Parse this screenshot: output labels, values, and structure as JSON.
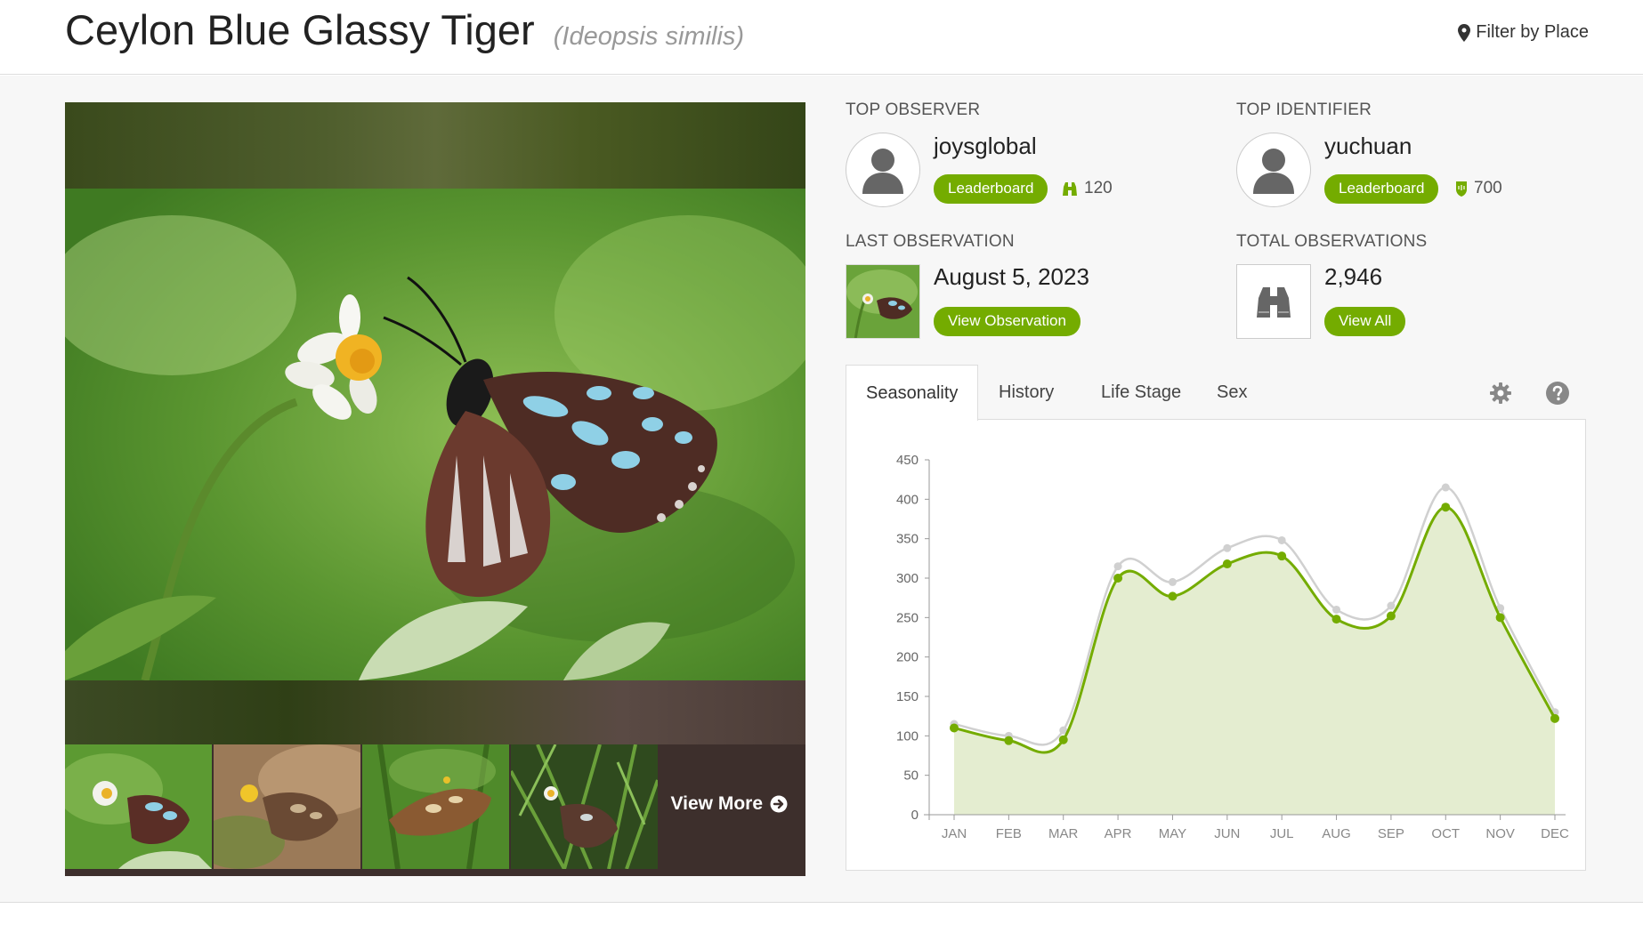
{
  "header": {
    "common_name": "Ceylon Blue Glassy Tiger",
    "scientific_name": "Ideopsis similis",
    "filter_label": "Filter by Place"
  },
  "photos": {
    "view_more_label": "View More"
  },
  "top_observer": {
    "label": "TOP OBSERVER",
    "name": "joysglobal",
    "leaderboard_label": "Leaderboard",
    "count": "120"
  },
  "top_identifier": {
    "label": "TOP IDENTIFIER",
    "name": "yuchuan",
    "leaderboard_label": "Leaderboard",
    "count": "700"
  },
  "last_observation": {
    "label": "LAST OBSERVATION",
    "date": "August 5, 2023",
    "button_label": "View Observation"
  },
  "total_observations": {
    "label": "TOTAL OBSERVATIONS",
    "value": "2,946",
    "button_label": "View All"
  },
  "tabs": [
    {
      "label": "Seasonality",
      "active": true
    },
    {
      "label": "History",
      "active": false
    },
    {
      "label": "Life Stage",
      "active": false
    },
    {
      "label": "Sex",
      "active": false
    }
  ],
  "icons": {
    "filter": "map-pin-icon",
    "view_more": "arrow-circle-right-icon",
    "observer_count": "binoculars-icon",
    "identifier_count": "shield-icon",
    "settings": "gear-icon",
    "help": "question-circle-icon"
  },
  "colors": {
    "accent": "#74ac00",
    "series_research": "#74ac00",
    "series_all": "#d0d0d0",
    "area_fill": "#e4edd0"
  },
  "chart_data": {
    "type": "line",
    "categories": [
      "JAN",
      "FEB",
      "MAR",
      "APR",
      "MAY",
      "JUN",
      "JUL",
      "AUG",
      "SEP",
      "OCT",
      "NOV",
      "DEC"
    ],
    "series": [
      {
        "values": [
          115,
          100,
          107,
          315,
          295,
          338,
          348,
          260,
          265,
          415,
          262,
          130
        ]
      },
      {
        "values": [
          110,
          94,
          95,
          300,
          277,
          318,
          328,
          248,
          252,
          390,
          250,
          122
        ]
      }
    ],
    "ylim": [
      0,
      450
    ],
    "yticks": [
      0,
      50,
      100,
      150,
      200,
      250,
      300,
      350,
      400,
      450
    ],
    "grid": false,
    "area_fill_series": 1
  }
}
